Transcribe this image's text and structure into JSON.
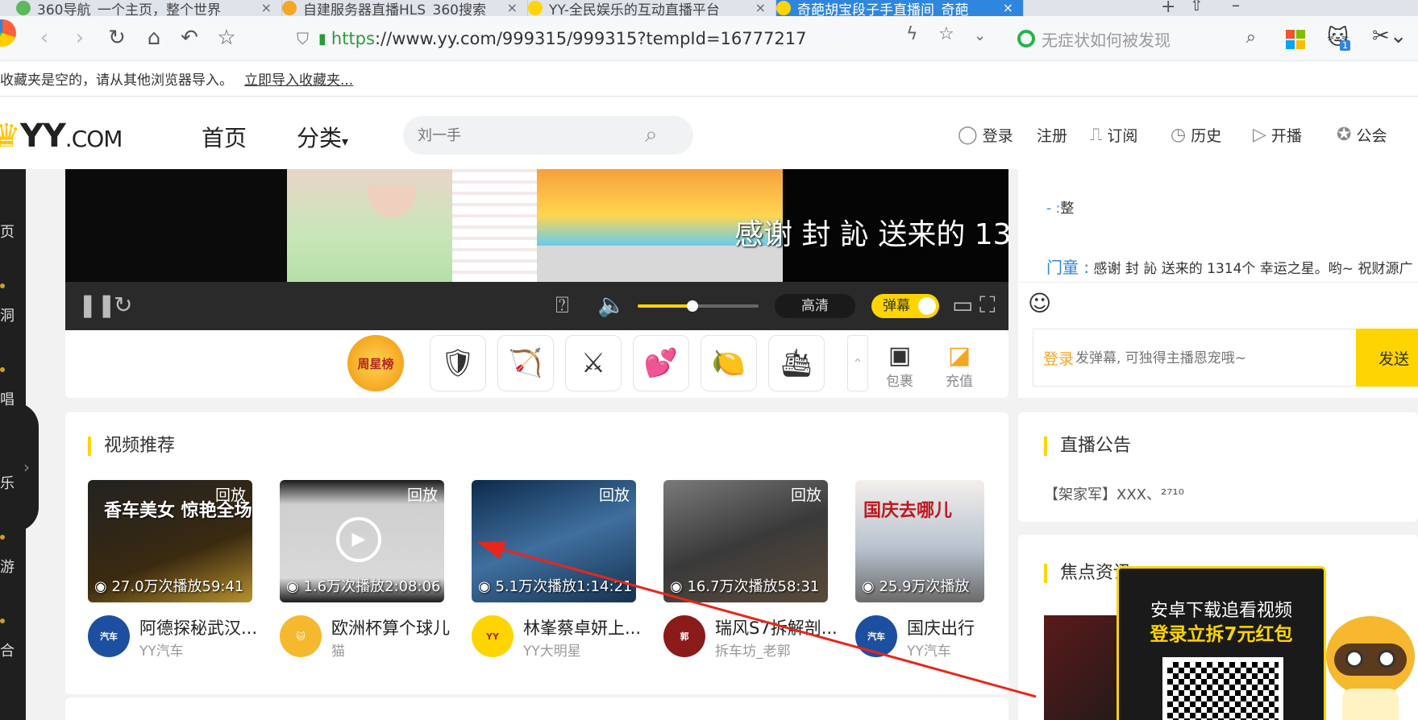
{
  "browser": {
    "tabs": [
      {
        "title": "360导航_一个主页，整个世界",
        "close": "×"
      },
      {
        "title": "自建服务器直播HLS_360搜索",
        "close": "×"
      },
      {
        "title": "YY-全民娱乐的互动直播平台",
        "close": "×"
      },
      {
        "title": "奇葩胡宝段子手直播间_奇葩",
        "close": "×"
      }
    ],
    "new_tab": "+",
    "url_scheme": "https",
    "url_rest": "://www.yy.com/999315/999315?tempId=16777217",
    "search_placeholder": "无症状如何被发现",
    "ext_badge_count": "1"
  },
  "bookmarks_bar": {
    "empty_text": "收藏夹是空的，请从其他浏览器导入。",
    "import_link": "立即导入收藏夹..."
  },
  "site_header": {
    "logo_text": "YY",
    "logo_suffix": ".COM",
    "nav": {
      "home": "首页",
      "category": "分类"
    },
    "search_placeholder": "刘一手",
    "links": {
      "login": "登录",
      "register": "注册",
      "subscribe": "订阅",
      "history": "历史",
      "broadcast": "开播",
      "guild": "公会"
    }
  },
  "left_rail": {
    "items": [
      "页",
      "洞",
      "唱",
      "乐",
      "游",
      "合"
    ]
  },
  "player": {
    "overlay_text": "感谢 封 訫 送来的 13",
    "quality": "高清",
    "danmu": "弹幕",
    "volume_fraction": 0.45
  },
  "giftbar": {
    "weekly_star": "周星榜",
    "actions": {
      "bag": "包裹",
      "recharge": "充值"
    }
  },
  "chat": {
    "line1_prefix": "- :",
    "line1_text": "整",
    "line2_user": "门童 :",
    "line2_text": "感谢 封 訫 送来的 1314个 幸运之星。哟~ 祝财源广",
    "login": "登录",
    "input_placeholder": "发弹幕, 可独得主播恩宠哦~",
    "send": "发送"
  },
  "recommend": {
    "title": "视频推荐",
    "videos": [
      {
        "replay": "回放",
        "stats": "27.0万次播放",
        "duration": "59:41",
        "title": "阿德探秘武汉...",
        "author": "YY汽车",
        "caption": "香车美女 惊艳全场"
      },
      {
        "replay": "回放",
        "stats": "1.6万次播放",
        "duration": "2:08:06",
        "title": "欧洲杯算个球儿",
        "author": "猫",
        "caption": ""
      },
      {
        "replay": "回放",
        "stats": "5.1万次播放",
        "duration": "1:14:21",
        "title": "林峯蔡卓妍上...",
        "author": "YY大明星",
        "caption": ""
      },
      {
        "replay": "回放",
        "stats": "16.7万次播放",
        "duration": "58:31",
        "title": "瑞风S7拆解剖...",
        "author": "拆车坊_老郭",
        "caption": ""
      },
      {
        "replay": "回放",
        "stats": "25.9万次播放",
        "duration": "",
        "title": "国庆出行",
        "author": "YY汽车",
        "caption": "国庆去哪儿"
      }
    ]
  },
  "notice": {
    "title": "直播公告",
    "text": "【架家军】XXX、²⁷¹⁰"
  },
  "focus": {
    "title": "焦点资讯"
  },
  "promo": {
    "line1": "安卓下载追看视频",
    "line2": "登录立拆7元红包"
  },
  "colors": {
    "accent": "#ffd400",
    "link_blue": "#2e86de",
    "annotation": "#e8261c"
  }
}
